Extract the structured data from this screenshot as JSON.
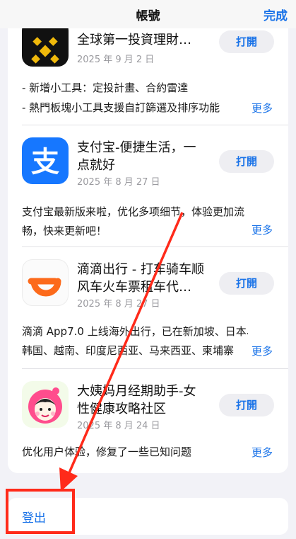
{
  "nav": {
    "title": "帳號",
    "done": "完成"
  },
  "apps": [
    {
      "name_line1": "全球第一投資理財…",
      "name_line2": "",
      "date": "2025 年 9 月 2 日",
      "button": "打開",
      "desc_lines": [
        "- 新增小工具：定投計畫、合約雷達",
        "- 熱門板塊小工具支援自訂篩選及排序功能"
      ],
      "more": "更多",
      "icon": "binance-icon"
    },
    {
      "name_line1": "支付宝-便捷生活，一",
      "name_line2": "点就好",
      "date": "2025 年 8 月 27 日",
      "button": "打開",
      "desc_lines": [
        "支付宝最新版来啦，优化多项细节，体验更加流",
        "畅，快来更新吧！"
      ],
      "more": "更多",
      "icon": "alipay-icon"
    },
    {
      "name_line1": "滴滴出行 - 打车骑车顺",
      "name_line2": "风车火车票租车代…",
      "date": "2025 年 8 月 27 日",
      "button": "打開",
      "desc_lines": [
        "滴滴 App7.0 上线海外出行，已在新加坡、日本、",
        "韩国、越南、印度尼西亚、马来西亚、柬埔寨"
      ],
      "more": "更多",
      "icon": "didi-icon"
    },
    {
      "name_line1": "大姨妈月经期助手-女",
      "name_line2": "性健康攻略社区",
      "date": "2025 年 8 月 24 日",
      "button": "打開",
      "desc_lines": [
        "优化用户体验，修复了一些已知问题"
      ],
      "more": "更多",
      "icon": "dayima-icon"
    }
  ],
  "logout": "登出",
  "colors": {
    "accent": "#1a73e8",
    "annotation": "#ff2a1a"
  }
}
